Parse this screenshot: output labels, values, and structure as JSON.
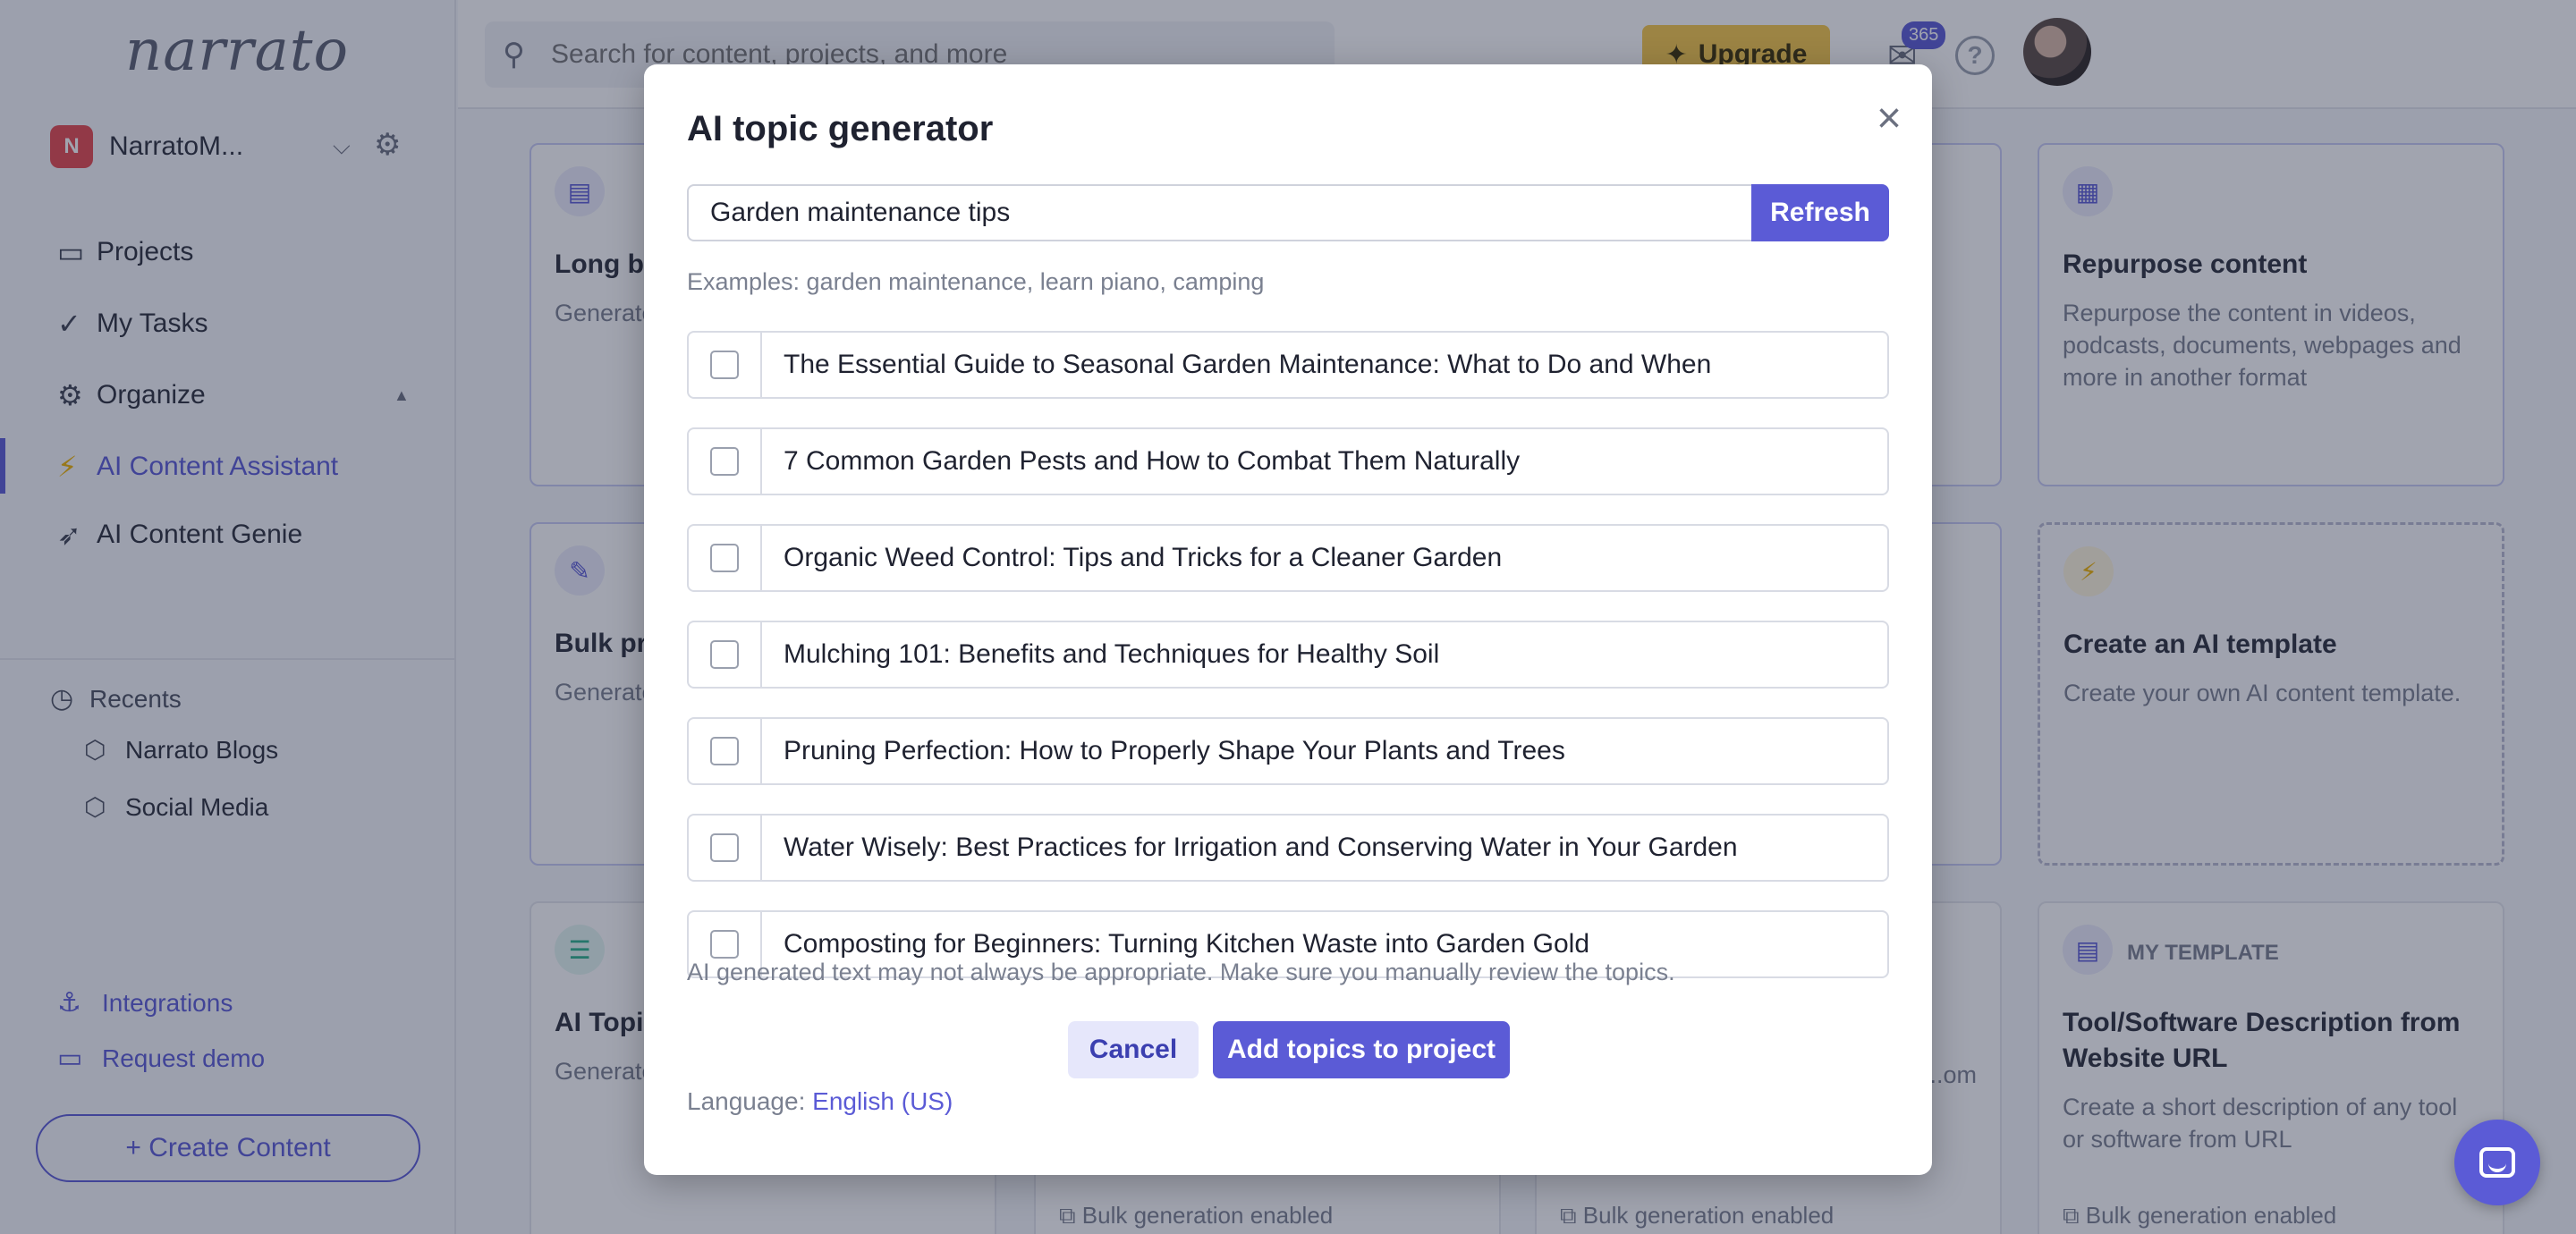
{
  "app": {
    "logo": "narrato"
  },
  "sidebar": {
    "workspace": {
      "badge": "N",
      "name": "NarratoM..."
    },
    "nav": [
      {
        "label": "Projects",
        "icon": "briefcase-icon"
      },
      {
        "label": "My Tasks",
        "icon": "check-icon"
      },
      {
        "label": "Organize",
        "icon": "settings-group-icon"
      },
      {
        "label": "AI Content Assistant",
        "icon": "lightning-icon",
        "active": true
      },
      {
        "label": "AI Content Genie",
        "icon": "rocket-icon"
      }
    ],
    "recents": {
      "title": "Recents",
      "items": [
        {
          "label": "Narrato Blogs",
          "icon": "cube-icon"
        },
        {
          "label": "Social Media",
          "icon": "cube-icon"
        }
      ]
    },
    "links": [
      {
        "label": "Integrations",
        "icon": "anchor-icon"
      },
      {
        "label": "Request demo",
        "icon": "monitor-icon"
      }
    ],
    "create_button": "+ Create Content"
  },
  "topbar": {
    "search_placeholder": "Search for content, projects, and more",
    "upgrade_label": "Upgrade",
    "mail_count": "365",
    "help_label": "?"
  },
  "cards": [
    {
      "title": "Long bl...",
      "desc": "Generate... keyword... tone"
    },
    {
      "title": "Repurpose content",
      "desc": "Repurpose the content in videos, podcasts, documents, webpages and more in another format"
    },
    {
      "title": "Bulk pro...",
      "desc": "Generate... descript..."
    },
    {
      "title": "Create an AI template",
      "desc": "Create your own AI content template."
    },
    {
      "title": "AI Topic...",
      "desc": "Generate..."
    },
    {
      "tag": "MY TEMPLATE",
      "title": "Tool/Software Description from Website URL",
      "desc": "Create a short description of any tool or software from URL",
      "foot": "Bulk generation enabled"
    },
    {
      "foot": "Bulk generation enabled"
    },
    {
      "desc": "...om",
      "foot": "Bulk generation enabled"
    }
  ],
  "modal": {
    "title": "AI topic generator",
    "close_label": "×",
    "input_value": "Garden maintenance tips",
    "refresh_label": "Refresh",
    "examples": "Examples: garden maintenance, learn piano, camping",
    "topics": [
      "The Essential Guide to Seasonal Garden Maintenance: What to Do and When",
      "7 Common Garden Pests and How to Combat Them Naturally",
      "Organic Weed Control: Tips and Tricks for a Cleaner Garden",
      "Mulching 101: Benefits and Techniques for Healthy Soil",
      "Pruning Perfection: How to Properly Shape Your Plants and Trees",
      "Water Wisely: Best Practices for Irrigation and Conserving Water in Your Garden",
      "Composting for Beginners: Turning Kitchen Waste into Garden Gold"
    ],
    "disclaimer": "AI generated text may not always be appropriate. Make sure you manually review the topics.",
    "cancel_label": "Cancel",
    "add_label": "Add topics to project",
    "language_label": "Language:",
    "language_value": "English (US)"
  },
  "colors": {
    "accent": "#5b5bd6",
    "upgrade": "#f7c948",
    "badge": "#e5484d"
  }
}
